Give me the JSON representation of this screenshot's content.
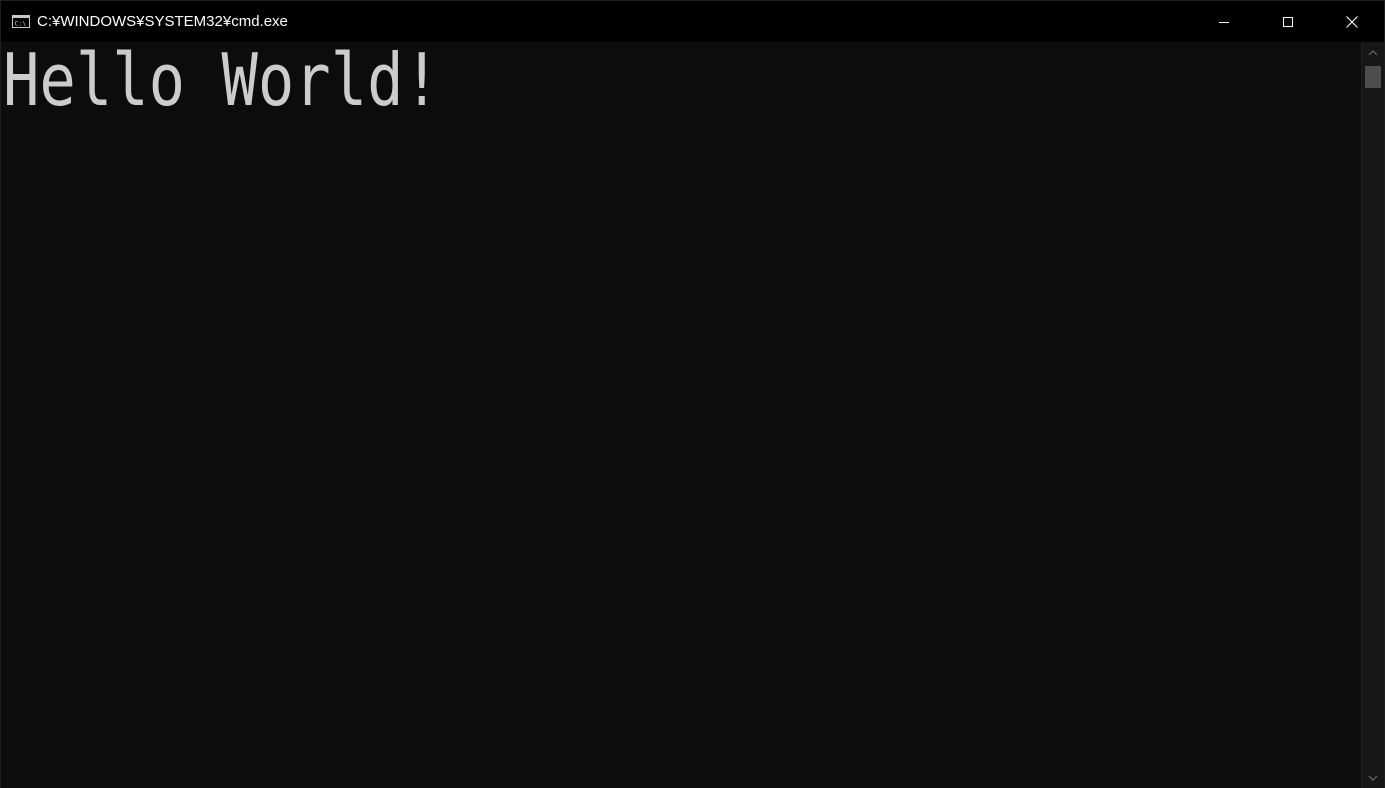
{
  "window": {
    "title": "C:¥WINDOWS¥SYSTEM32¥cmd.exe",
    "icon": "cmd-console-icon",
    "app_icon_label": "C:\\",
    "buttons": {
      "minimize": "minimize-icon",
      "maximize": "maximize-icon",
      "close": "close-icon"
    }
  },
  "console": {
    "output_lines": [
      "Hello World!"
    ],
    "text_color": "#cccccc",
    "background_color": "#0c0c0c"
  },
  "scrollbar": {
    "up_icon": "chevron-up-icon",
    "down_icon": "chevron-down-icon"
  }
}
